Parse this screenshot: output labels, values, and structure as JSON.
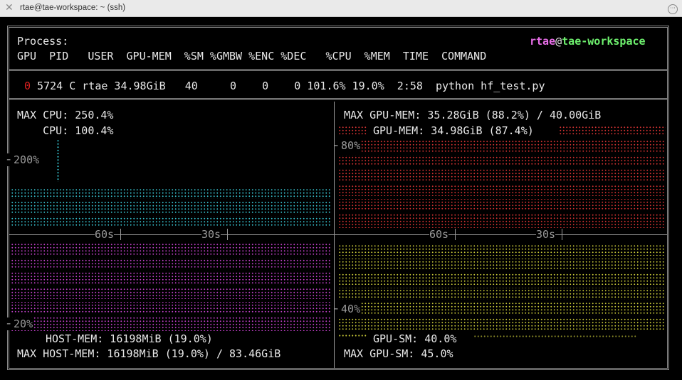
{
  "window": {
    "title": "rtae@tae-workspace: ~ (ssh)"
  },
  "header": {
    "process_label": "Process:",
    "user": "rtae",
    "at": "@",
    "host": "tae-workspace",
    "columns": "GPU  PID   USER  GPU-MEM  %SM %GMBW %ENC %DEC   %CPU  %MEM  TIME  COMMAND"
  },
  "process_row": {
    "gpu": "0",
    "rest": " 5724 C rtae 34.98GiB   40     0    0    0 101.6% 19.0%  2:58  python hf_test.py"
  },
  "cpu_panel": {
    "max_cpu": "MAX CPU: 250.4%",
    "cpu": "    CPU: 100.4%",
    "y_label": "200%",
    "cpu_percent": 100.4,
    "max_cpu_percent": 250.4
  },
  "gpu_mem_panel": {
    "max_gpu_mem": "MAX GPU-MEM: 35.28GiB (88.2%) / 40.00GiB",
    "gpu_mem": "GPU-MEM: 34.98GiB (87.4%)",
    "y_label": "80%",
    "gpu_mem_percent": 87.4
  },
  "time_axis": {
    "left_60": "60s",
    "left_30": "30s",
    "right_60": "60s",
    "right_30": "30s"
  },
  "host_mem_panel": {
    "y_label": "20%",
    "host_mem": "HOST-MEM: 16198MiB (19.0%)",
    "max_host_mem": "MAX HOST-MEM: 16198MiB (19.0%) / 83.46GiB",
    "host_mem_percent": 19.0
  },
  "gpu_sm_panel": {
    "y_label": "40%",
    "gpu_sm": "GPU-SM: 40.0%",
    "max_gpu_sm": "MAX GPU-SM: 45.0%",
    "gpu_sm_percent": 40.0,
    "max_gpu_sm_percent": 45.0
  },
  "colors": {
    "user": "#e86ee8",
    "host": "#6ef06e",
    "gpu_index": "#e02020",
    "cpu": "#38c4d0",
    "gpu_mem": "#d23232",
    "host_mem": "#c040c8",
    "gpu_sm": "#c8c838"
  }
}
